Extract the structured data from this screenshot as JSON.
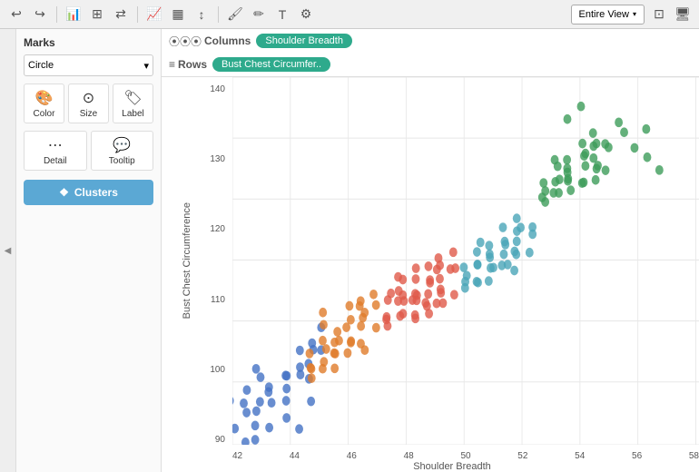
{
  "toolbar": {
    "entire_view_label": "Entire View",
    "icons": [
      "undo",
      "redo",
      "bar-chart",
      "table",
      "grid",
      "settings",
      "filter",
      "sort",
      "format",
      "brush",
      "text",
      "analytics"
    ]
  },
  "sidebar": {
    "toggle_label": "◀",
    "marks_title": "Marks",
    "marks_type": "Circle",
    "buttons": [
      {
        "label": "Color",
        "icon": "🎨"
      },
      {
        "label": "Size",
        "icon": "⊙"
      },
      {
        "label": "Label",
        "icon": "🏷"
      },
      {
        "label": "Detail",
        "icon": "⋯"
      },
      {
        "label": "Tooltip",
        "icon": "💬"
      }
    ],
    "clusters_label": "Clusters",
    "clusters_icon": "❖"
  },
  "chart": {
    "columns_label": "Columns",
    "rows_label": "Rows",
    "column_field": "Shoulder Breadth",
    "row_field": "Bust Chest Circumfer..",
    "x_axis_label": "Shoulder Breadth",
    "y_axis_label": "Bust Chest Circumference",
    "x_ticks": [
      "42",
      "44",
      "46",
      "48",
      "50",
      "52",
      "54",
      "56",
      "58"
    ],
    "y_ticks": [
      "140",
      "130",
      "120",
      "110",
      "100",
      "90"
    ],
    "scatter_data": {
      "blue": [
        [
          42,
          92
        ],
        [
          41.5,
          90
        ],
        [
          42.5,
          94
        ],
        [
          41,
          88
        ],
        [
          43,
          96
        ],
        [
          42,
          98
        ],
        [
          43.5,
          100
        ],
        [
          41.5,
          86
        ],
        [
          44,
          102
        ],
        [
          42,
          90
        ],
        [
          43,
          94
        ],
        [
          41,
          92
        ],
        [
          43.5,
          96
        ],
        [
          42.5,
          88
        ],
        [
          44,
          98
        ],
        [
          43,
          92
        ],
        [
          44.5,
          104
        ],
        [
          42,
          86
        ],
        [
          43.5,
          98
        ],
        [
          41.5,
          94
        ],
        [
          44,
          96
        ],
        [
          42.5,
          92
        ],
        [
          43,
          90
        ],
        [
          44.5,
          100
        ],
        [
          42,
          88
        ],
        [
          43,
          96
        ],
        [
          41.5,
          92
        ],
        [
          44,
          100
        ],
        [
          42.5,
          94
        ],
        [
          43.5,
          88
        ],
        [
          44,
          92
        ],
        [
          42,
          96
        ]
      ],
      "orange": [
        [
          44,
          98
        ],
        [
          45,
          102
        ],
        [
          44.5,
          100
        ],
        [
          45.5,
          104
        ],
        [
          44,
          96
        ],
        [
          45,
          100
        ],
        [
          46,
          106
        ],
        [
          44.5,
          98
        ],
        [
          45.5,
          102
        ],
        [
          44,
          100
        ],
        [
          46,
          108
        ],
        [
          45,
          104
        ],
        [
          44.5,
          102
        ],
        [
          46.5,
          110
        ],
        [
          45,
          98
        ],
        [
          46,
          104
        ],
        [
          44.5,
          106
        ],
        [
          45.5,
          100
        ],
        [
          46,
          102
        ],
        [
          44,
          98
        ],
        [
          45.5,
          106
        ],
        [
          46.5,
          108
        ],
        [
          45,
          102
        ],
        [
          46,
          100
        ],
        [
          44.5,
          104
        ],
        [
          45.5,
          108
        ],
        [
          46,
          106
        ],
        [
          45,
          100
        ],
        [
          44.5,
          98
        ],
        [
          46.5,
          104
        ],
        [
          45.5,
          102
        ],
        [
          46,
          108
        ]
      ],
      "red": [
        [
          47,
          106
        ],
        [
          48,
          110
        ],
        [
          47.5,
          108
        ],
        [
          48.5,
          112
        ],
        [
          47,
          104
        ],
        [
          48,
          108
        ],
        [
          49,
          114
        ],
        [
          47.5,
          106
        ],
        [
          48.5,
          110
        ],
        [
          47,
          108
        ],
        [
          49,
          116
        ],
        [
          48,
          112
        ],
        [
          47.5,
          110
        ],
        [
          49.5,
          114
        ],
        [
          48,
          106
        ],
        [
          49,
          110
        ],
        [
          47.5,
          112
        ],
        [
          48.5,
          108
        ],
        [
          49,
          110
        ],
        [
          47,
          106
        ],
        [
          48.5,
          112
        ],
        [
          49.5,
          114
        ],
        [
          48,
          110
        ],
        [
          49,
          108
        ],
        [
          47.5,
          108
        ],
        [
          48.5,
          114
        ],
        [
          49,
          112
        ],
        [
          48,
          108
        ],
        [
          47.5,
          106
        ],
        [
          49.5,
          110
        ],
        [
          48.5,
          108
        ],
        [
          49,
          114
        ],
        [
          47,
          110
        ],
        [
          48,
          106
        ],
        [
          49.5,
          116
        ],
        [
          47.5,
          112
        ],
        [
          48,
          114
        ],
        [
          49,
          108
        ],
        [
          47.5,
          110
        ],
        [
          48.5,
          106
        ]
      ],
      "teal": [
        [
          50,
          112
        ],
        [
          51,
          116
        ],
        [
          50.5,
          114
        ],
        [
          51.5,
          118
        ],
        [
          50,
          110
        ],
        [
          51,
          114
        ],
        [
          52,
          120
        ],
        [
          50.5,
          112
        ],
        [
          51.5,
          116
        ],
        [
          50,
          114
        ],
        [
          52,
          122
        ],
        [
          51,
          118
        ],
        [
          50.5,
          116
        ],
        [
          52.5,
          120
        ],
        [
          51,
          112
        ],
        [
          52,
          116
        ],
        [
          50.5,
          118
        ],
        [
          51.5,
          114
        ],
        [
          52,
          116
        ],
        [
          50,
          112
        ],
        [
          51.5,
          118
        ],
        [
          52.5,
          120
        ],
        [
          51,
          116
        ],
        [
          52,
          114
        ],
        [
          50.5,
          114
        ],
        [
          51.5,
          120
        ],
        [
          52,
          118
        ],
        [
          51,
          114
        ],
        [
          50.5,
          112
        ],
        [
          52.5,
          116
        ],
        [
          51.5,
          114
        ],
        [
          52,
          120
        ]
      ],
      "green": [
        [
          53,
          126
        ],
        [
          54,
          130
        ],
        [
          53.5,
          128
        ],
        [
          54.5,
          132
        ],
        [
          53,
          124
        ],
        [
          54,
          128
        ],
        [
          55,
          134
        ],
        [
          53.5,
          126
        ],
        [
          54.5,
          130
        ],
        [
          53,
          128
        ],
        [
          55,
          136
        ],
        [
          54,
          132
        ],
        [
          53.5,
          130
        ],
        [
          55.5,
          134
        ],
        [
          54,
          126
        ],
        [
          55,
          130
        ],
        [
          53.5,
          132
        ],
        [
          54.5,
          128
        ],
        [
          55,
          130
        ],
        [
          53,
          126
        ],
        [
          54.5,
          132
        ],
        [
          55.5,
          134
        ],
        [
          54,
          130
        ],
        [
          55,
          128
        ],
        [
          53.5,
          128
        ],
        [
          54.5,
          134
        ],
        [
          55,
          132
        ],
        [
          54,
          128
        ],
        [
          53.5,
          126
        ],
        [
          55.5,
          130
        ],
        [
          54.5,
          128
        ],
        [
          55,
          134
        ],
        [
          54,
          138
        ],
        [
          56,
          136
        ],
        [
          57,
          132
        ],
        [
          56.5,
          134
        ],
        [
          57.5,
          130
        ],
        [
          54.5,
          140
        ],
        [
          56,
          138
        ],
        [
          57,
          136
        ]
      ]
    },
    "colors": {
      "blue": "#4472c4",
      "orange": "#e07c2a",
      "red": "#e05a4a",
      "teal": "#4aa5b8",
      "green": "#3d9c5a"
    }
  }
}
